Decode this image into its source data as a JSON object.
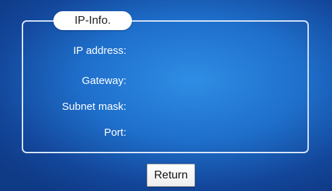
{
  "panel": {
    "title": "IP-Info."
  },
  "fields": [
    {
      "label": "IP address:",
      "value": ""
    },
    {
      "label": "Gateway:",
      "value": ""
    },
    {
      "label": "Subnet mask:",
      "value": ""
    },
    {
      "label": "Port:",
      "value": ""
    }
  ],
  "footer": {
    "return_label": "Return"
  }
}
